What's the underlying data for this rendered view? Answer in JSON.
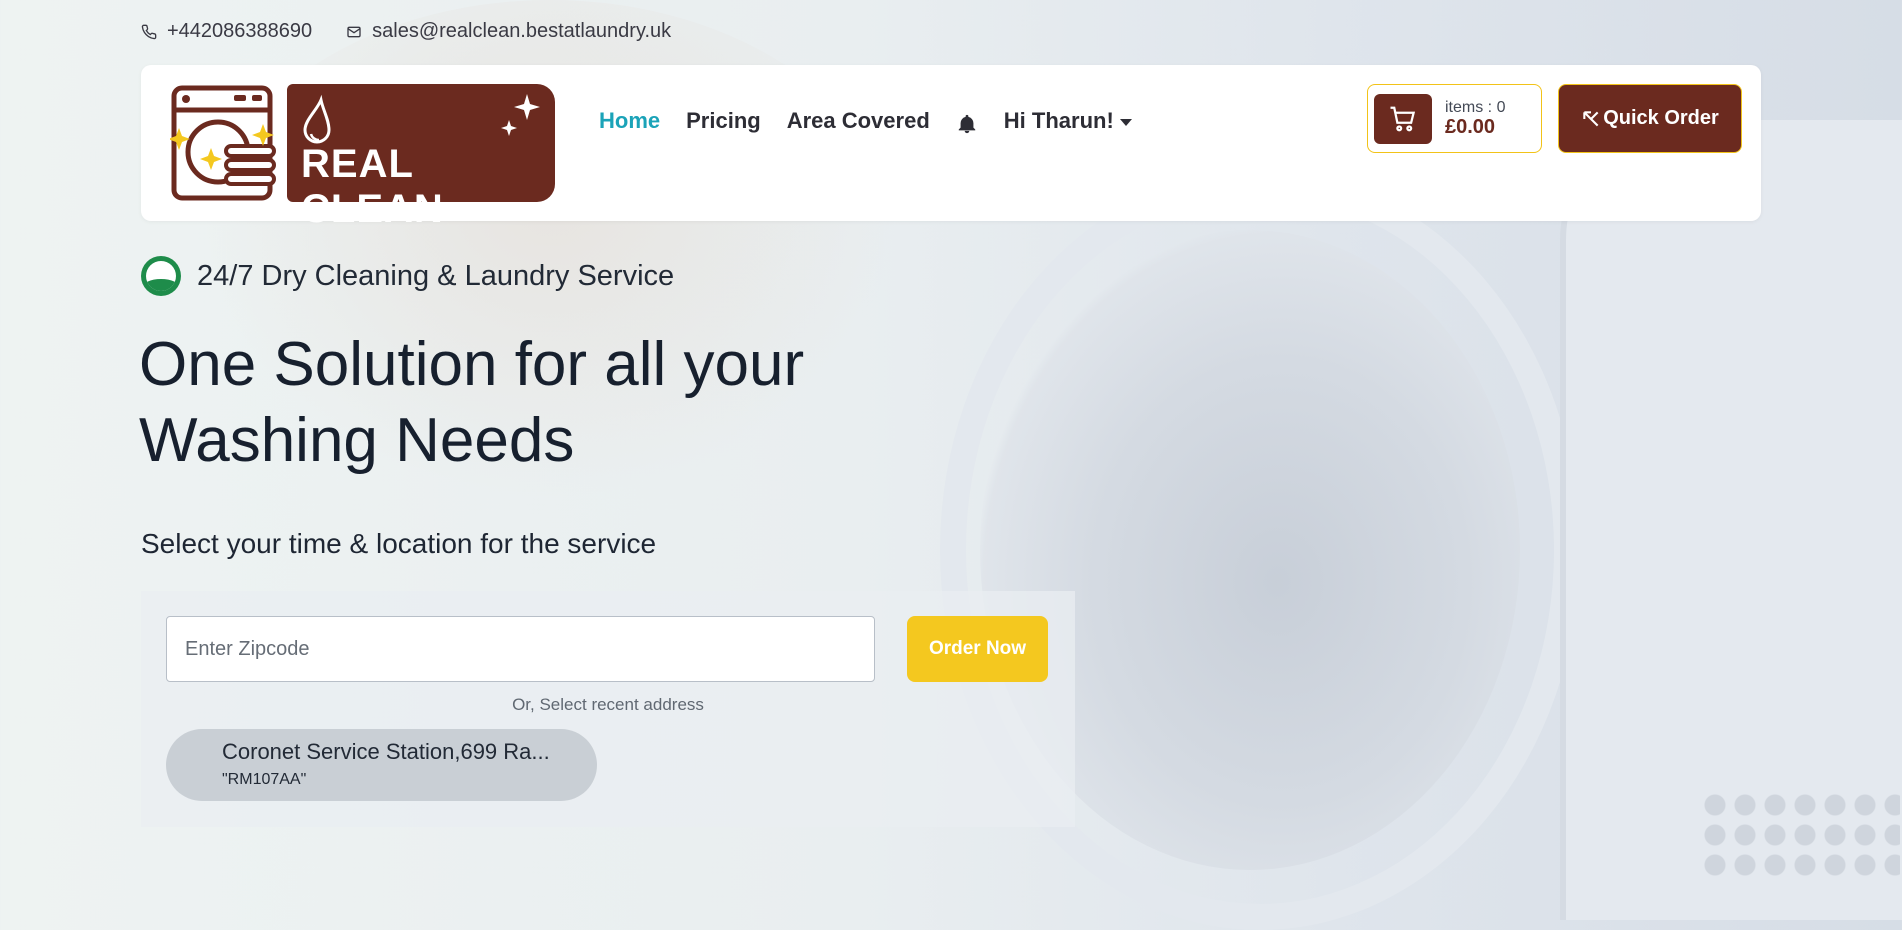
{
  "contact": {
    "phone": "+442086388690",
    "email": "sales@realclean.bestatlaundry.uk"
  },
  "brand": {
    "name": "REAL CLEAN",
    "color": "#6b2a1f",
    "accent": "#f4c81f"
  },
  "nav": {
    "items": [
      {
        "label": "Home",
        "active": true
      },
      {
        "label": "Pricing"
      },
      {
        "label": "Area Covered"
      }
    ],
    "bell_icon": "bell-icon",
    "user_greeting": "Hi Tharun!"
  },
  "cart": {
    "items_label": "items : 0",
    "total": "£0.00"
  },
  "quick_order": {
    "label": "Quick Order"
  },
  "hero": {
    "tagline": "24/7 Dry Cleaning & Laundry Service",
    "headline": "One Solution for all your Washing Needs",
    "subhead": "Select your time & location for the service"
  },
  "order_form": {
    "zip_placeholder": "Enter Zipcode",
    "zip_value": "",
    "submit_label": "Order Now",
    "or_text": "Or, Select recent address",
    "recent": [
      {
        "name": "Coronet Service Station,699 Ra...",
        "zip": "\"RM107AA\""
      }
    ]
  }
}
